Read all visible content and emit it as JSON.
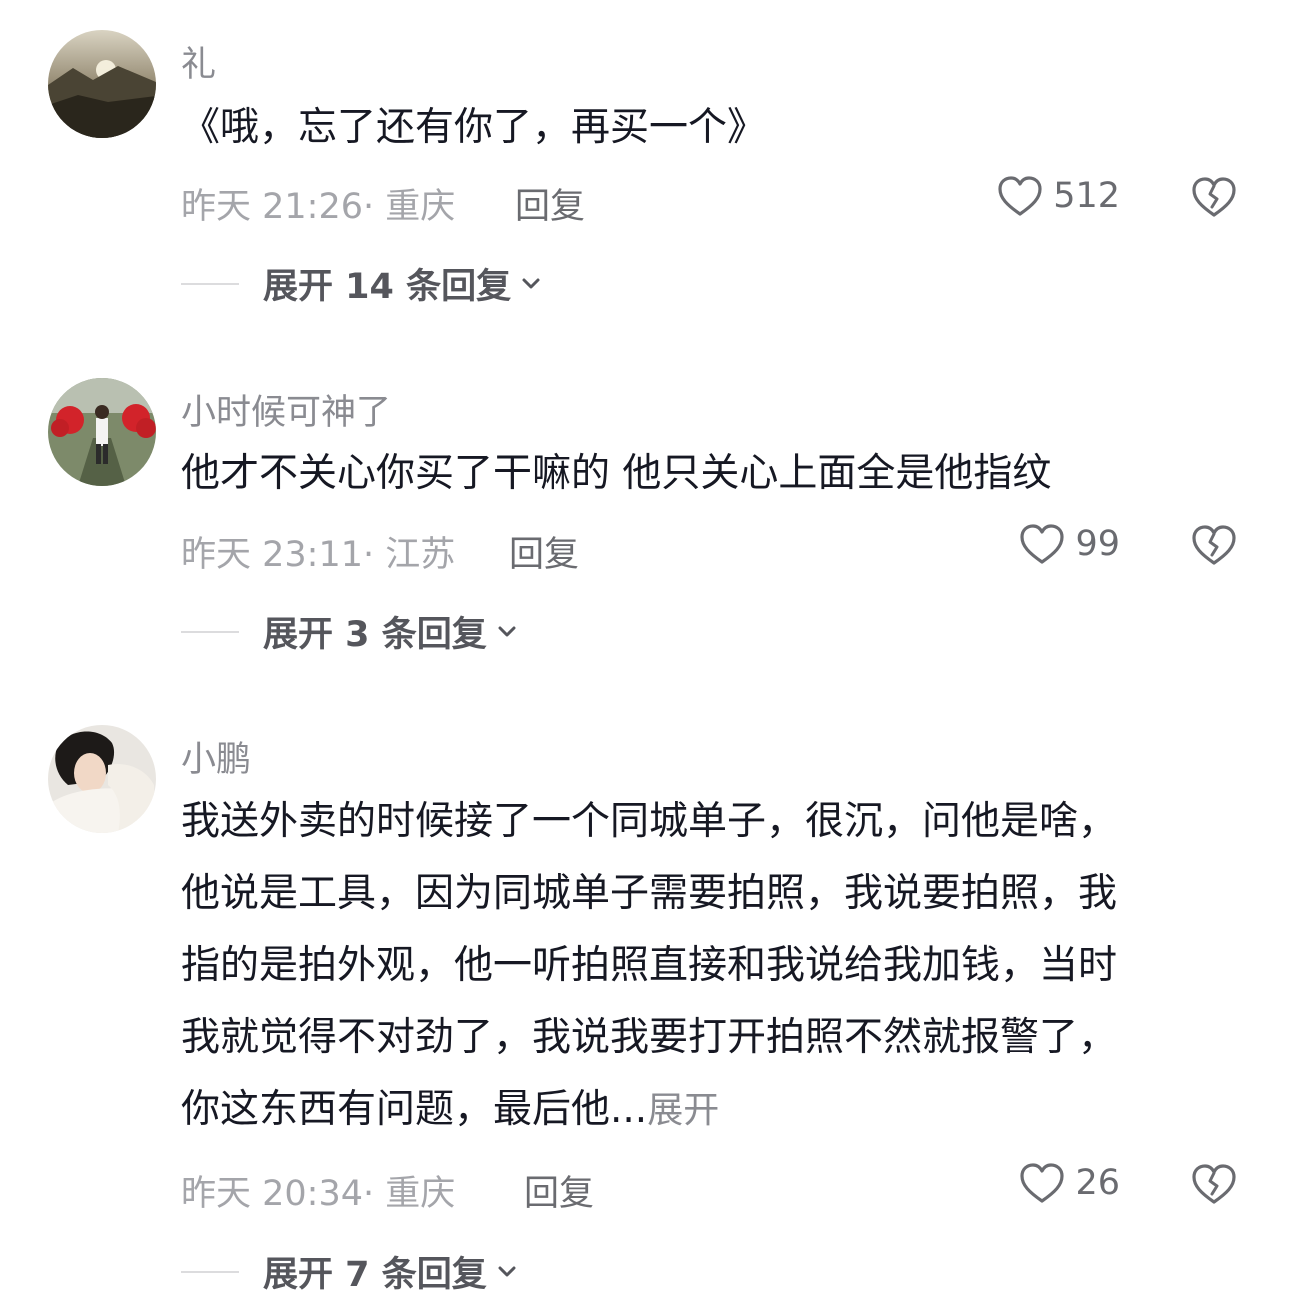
{
  "comments": [
    {
      "username": "礼",
      "text_lines": [
        "《哦，忘了还有你了，再买一个》"
      ],
      "timestamp": "昨天 21:26",
      "location": "重庆",
      "reply_label": "回复",
      "likes": "512",
      "expand_replies": "展开 14 条回复"
    },
    {
      "username": "小时候可神了",
      "text_lines": [
        "他才不关心你买了干嘛的 他只关心上面全是他指纹"
      ],
      "timestamp": "昨天 23:11",
      "location": "江苏",
      "reply_label": "回复",
      "likes": "99",
      "expand_replies": "展开 3 条回复"
    },
    {
      "username": "小鹏",
      "text_lines": [
        "我送外卖的时候接了一个同城单子，很沉，问他是啥，",
        "他说是工具，因为同城单子需要拍照，我说要拍照，我",
        "指的是拍外观，他一听拍照直接和我说给我加钱，当时",
        "我就觉得不对劲了，我说我要打开拍照不然就报警了，",
        "你这东西有问题，最后他..."
      ],
      "expand_inline": "展开",
      "timestamp": "昨天 20:34",
      "location": "重庆",
      "reply_label": "回复",
      "likes": "26",
      "expand_replies": "展开 7 条回复"
    }
  ],
  "icons": {
    "like": "heart-outline-icon",
    "dislike": "broken-heart-icon",
    "expand": "chevron-down-icon"
  },
  "colors": {
    "text": "#161823",
    "secondary": "#8a8b91",
    "meta": "#a4a5aa"
  }
}
